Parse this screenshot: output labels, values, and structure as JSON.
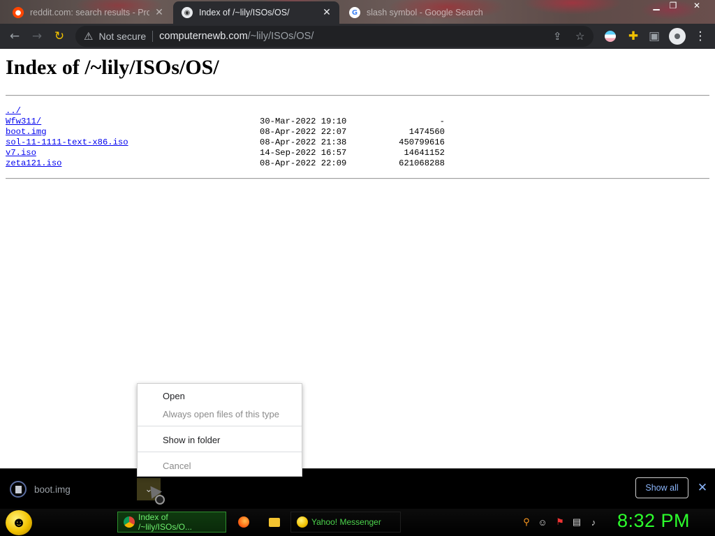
{
  "browser": {
    "tabs": [
      {
        "title": "reddit.com: search results - Pro…",
        "favicon": "reddit-icon",
        "active": false
      },
      {
        "title": "Index of /~lily/ISOs/OS/",
        "favicon": "gnu-icon",
        "active": true
      },
      {
        "title": "slash symbol - Google Search",
        "favicon": "google-icon",
        "active": false
      }
    ],
    "address": {
      "security_label": "Not secure",
      "host": "computernewb.com",
      "path": "/~lily/ISOs/OS/"
    }
  },
  "page": {
    "heading": "Index of /~lily/ISOs/OS/",
    "parent_link": "../",
    "entries": [
      {
        "name": "Wfw311/",
        "date": "30-Mar-2022 19:10",
        "size": "-"
      },
      {
        "name": "boot.img",
        "date": "08-Apr-2022 22:07",
        "size": "1474560"
      },
      {
        "name": "sol-11-1111-text-x86.iso",
        "date": "08-Apr-2022 21:38",
        "size": "450799616"
      },
      {
        "name": "v7.iso",
        "date": "14-Sep-2022 16:57",
        "size": "14641152"
      },
      {
        "name": "zeta121.iso",
        "date": "08-Apr-2022 22:09",
        "size": "621068288"
      }
    ]
  },
  "context_menu": {
    "open": "Open",
    "always_open": "Always open files of this type",
    "show_in_folder": "Show in folder",
    "cancel": "Cancel"
  },
  "download_shelf": {
    "filename": "boot.img",
    "show_all": "Show all"
  },
  "taskbar": {
    "tasks": [
      {
        "label": "Index of /~lily/ISOs/O...",
        "icon": "chrome-icon"
      },
      {
        "label": "Yahoo! Messenger",
        "icon": "yahoo-messenger-icon"
      }
    ],
    "clock": "8:32 PM"
  },
  "colors": {
    "link": "#0000ee",
    "toolbar_bg": "#2a2b2f",
    "shelf_link": "#8ab4f8",
    "clock": "#2cff2c"
  }
}
